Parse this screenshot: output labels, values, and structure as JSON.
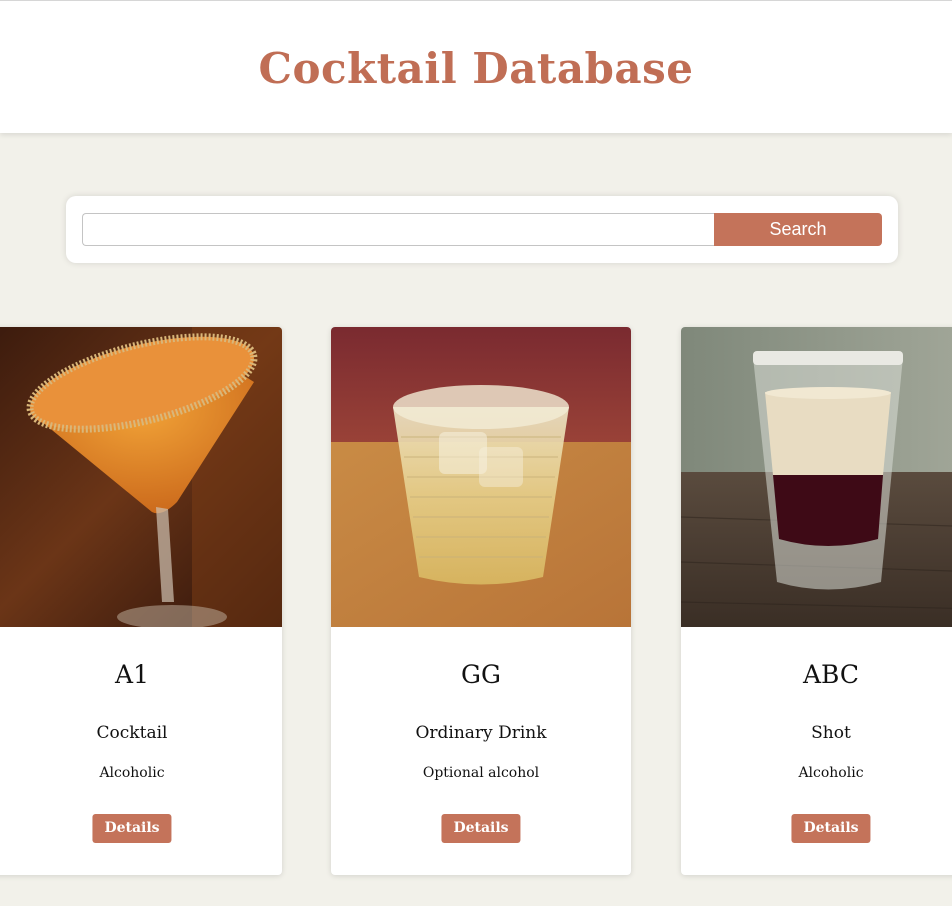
{
  "header": {
    "title": "Cocktail Database"
  },
  "search": {
    "value": "",
    "placeholder": "",
    "button_label": "Search"
  },
  "cards": [
    {
      "name": "A1",
      "category": "Cocktail",
      "alcoholic": "Alcoholic",
      "details_label": "Details",
      "image": "orange-martini-glass-photo"
    },
    {
      "name": "GG",
      "category": "Ordinary Drink",
      "alcoholic": "Optional alcohol",
      "details_label": "Details",
      "image": "ribbed-tumbler-glass-photo"
    },
    {
      "name": "ABC",
      "category": "Shot",
      "alcoholic": "Alcoholic",
      "details_label": "Details",
      "image": "layered-shot-glass-photo"
    }
  ],
  "colors": {
    "accent": "#c4735a",
    "title": "#c06e55",
    "page_background": "#f2f1ea",
    "card_background": "#ffffff"
  }
}
